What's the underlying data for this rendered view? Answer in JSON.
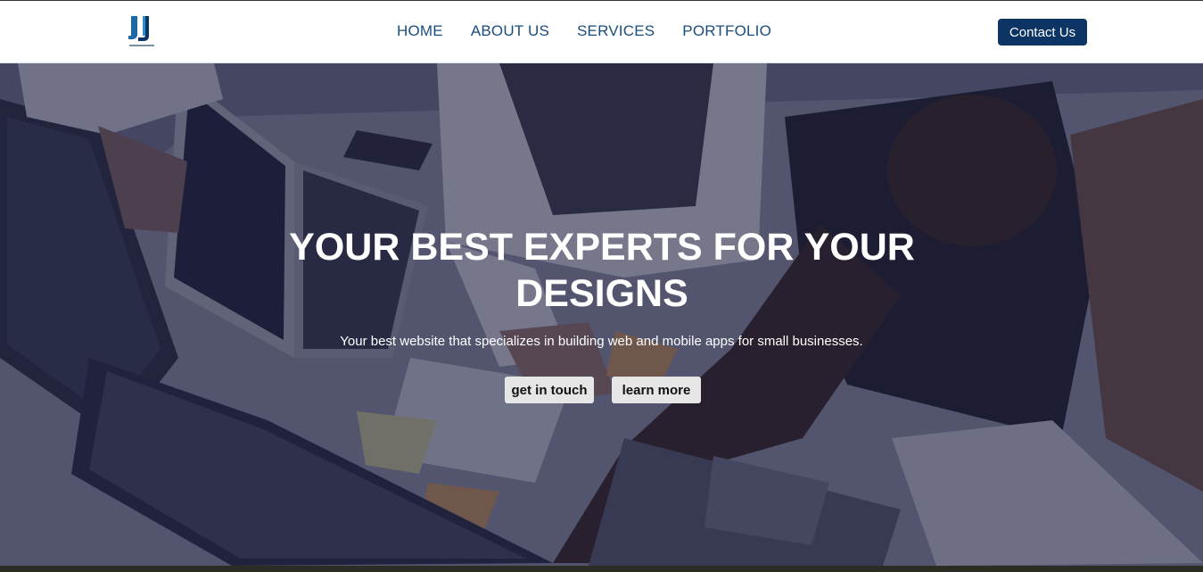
{
  "brand": {
    "logo_icon": "jj-monogram-logo",
    "color": "#1b6aa5"
  },
  "nav": {
    "links": [
      "HOME",
      "ABOUT US",
      "SERVICES",
      "PORTFOLIO"
    ],
    "contact_label": "Contact Us",
    "link_color": "#1b4e7a",
    "contact_bg": "#0c3565"
  },
  "hero": {
    "title": "YOUR BEST EXPERTS FOR YOUR DESIGNS",
    "subtitle": "Your best website that specializes in building web and mobile apps for small businesses.",
    "primary_button": "get in touch",
    "secondary_button": "learn more",
    "background": "office-team-photo"
  }
}
